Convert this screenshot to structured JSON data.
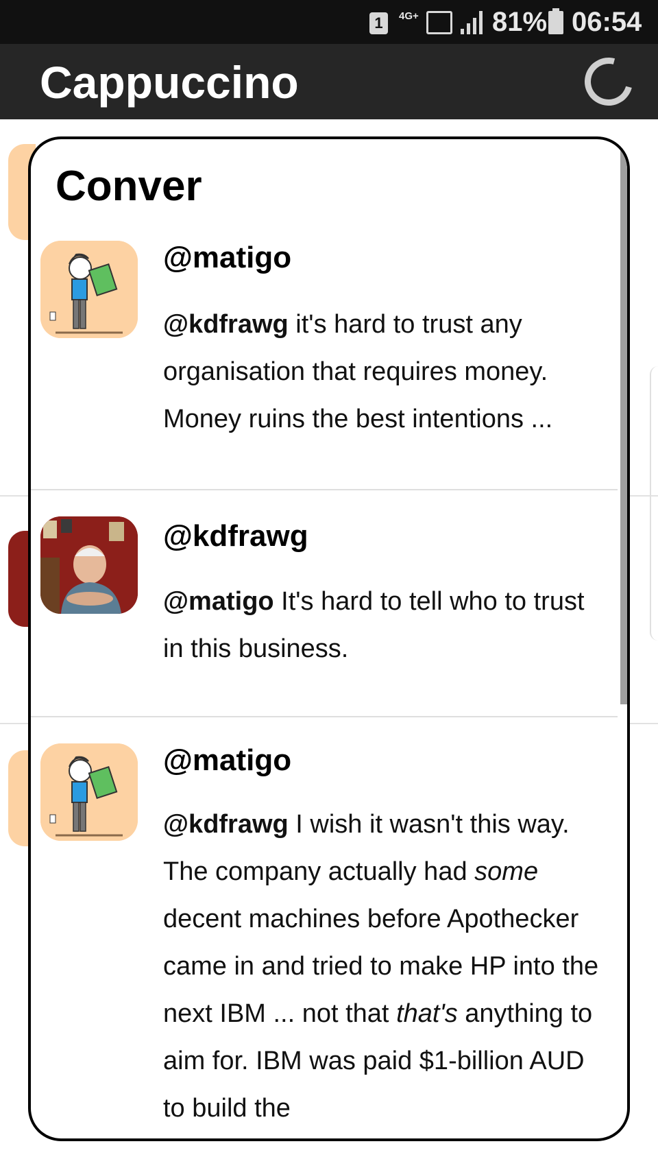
{
  "status_bar": {
    "sim": "1",
    "network": "4G+",
    "battery": "81%",
    "time": "06:54"
  },
  "app_bar": {
    "title": "Cappuccino",
    "refresh_icon": "refresh-icon"
  },
  "dialog": {
    "title": "Conver",
    "items": [
      {
        "handle": "@matigo",
        "avatar": "cartoon-reader-avatar",
        "mention": "@kdfrawg",
        "text": " it's hard to trust any organisation that requires money. Money ruins the best intentions ..."
      },
      {
        "handle": "@kdfrawg",
        "avatar": "photo-avatar",
        "mention": "@matigo",
        "text": " It's hard to tell who to trust in this business."
      },
      {
        "handle": "@matigo",
        "avatar": "cartoon-reader-avatar",
        "mention": "@kdfrawg",
        "text_a": " I wish it wasn't this way. The company actually had ",
        "em_a": "some",
        "text_b": " decent machines before Apothecker came in and tried to make HP into the next IBM ... not that ",
        "em_b": "that's",
        "text_c": " anything to aim for. IBM was paid $1-billion AUD to build the"
      }
    ]
  }
}
